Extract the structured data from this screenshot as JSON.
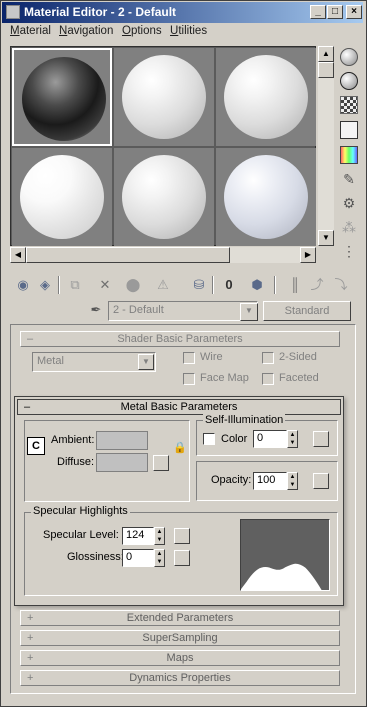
{
  "window": {
    "title": "Material Editor - 2 - Default",
    "minimize_symbol": "_",
    "maximize_symbol": "□",
    "close_symbol": "×"
  },
  "menu": {
    "items": [
      {
        "label": "Material",
        "underline": "M",
        "rest": "aterial"
      },
      {
        "label": "Navigation",
        "underline": "N",
        "rest": "avigation"
      },
      {
        "label": "Options",
        "underline": "O",
        "rest": "ptions"
      },
      {
        "label": "Utilities",
        "underline": "U",
        "rest": "tilities"
      }
    ]
  },
  "material_name_row": {
    "name": "2 - Default",
    "type_button": "Standard"
  },
  "shader_basic": {
    "title": "Shader Basic Parameters",
    "collapse_sign": "–",
    "shader_type": "Metal",
    "wire_label": "Wire",
    "two_sided_label": "2-Sided",
    "face_map_label": "Face Map",
    "faceted_label": "Faceted"
  },
  "metal_basic": {
    "title": "Metal Basic Parameters",
    "collapse_sign": "–",
    "lock_label": "C",
    "ambient_label": "Ambient:",
    "diffuse_label": "Diffuse:",
    "self_illum": {
      "title": "Self-Illumination",
      "color_label": "Color",
      "value": "0"
    },
    "opacity_label": "Opacity:",
    "opacity_value": "100",
    "specular": {
      "title": "Specular Highlights",
      "level_label": "Specular Level:",
      "level_value": "124",
      "glossiness_label": "Glossiness:",
      "glossiness_value": "0"
    }
  },
  "collapsed_rollouts": [
    {
      "sign": "+",
      "title": "Extended Parameters"
    },
    {
      "sign": "+",
      "title": "SuperSampling"
    },
    {
      "sign": "+",
      "title": "Maps"
    },
    {
      "sign": "+",
      "title": "Dynamics Properties"
    }
  ],
  "colors": {
    "titlebar_start": "#0a246a",
    "titlebar_end": "#a6caf0",
    "window_bg": "#d4d0c8",
    "slot_bg": "#5b5b5b"
  }
}
